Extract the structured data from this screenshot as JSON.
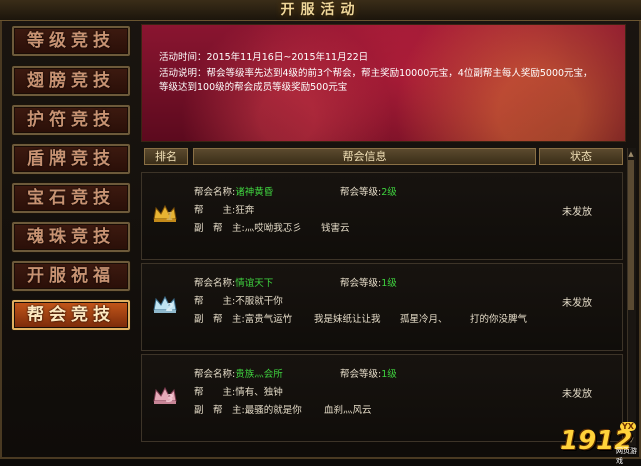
{
  "window": {
    "title": "开服活动"
  },
  "sidebar": {
    "items": [
      {
        "label": "等级竞技",
        "active": false
      },
      {
        "label": "翅膀竞技",
        "active": false
      },
      {
        "label": "护符竞技",
        "active": false
      },
      {
        "label": "盾牌竞技",
        "active": false
      },
      {
        "label": "宝石竞技",
        "active": false
      },
      {
        "label": "魂珠竞技",
        "active": false
      },
      {
        "label": "开服祝福",
        "active": false
      },
      {
        "label": "帮会竞技",
        "active": true
      }
    ]
  },
  "banner": {
    "time": "活动时间：2015年11月16日~2015年11月22日",
    "desc1": "活动说明：帮会等级率先达到4级的前3个帮会，帮主奖励10000元宝，4位副帮主每人奖励5000元宝，",
    "desc2": "等级达到100级的帮会成员等级奖励500元宝"
  },
  "table": {
    "headers": {
      "rank": "排名",
      "info": "帮会信息",
      "status": "状态"
    },
    "rows": [
      {
        "rank": "1",
        "name_label": "帮会名称:",
        "name": "诸神黄昏",
        "level_label": "帮会等级:",
        "level": "2级",
        "leader_label": "帮　　主:",
        "leader": "狂奔",
        "vice_label": "副　帮　主:",
        "vices": [
          "灬哎呦我忑彡",
          "钱害云"
        ],
        "status": "未发放"
      },
      {
        "rank": "2",
        "name_label": "帮会名称:",
        "name": "情谊天下",
        "level_label": "帮会等级:",
        "level": "1级",
        "leader_label": "帮　　主:",
        "leader": "不服就干你",
        "vice_label": "副　帮　主:",
        "vices": [
          "富贵气运竹",
          "我是妹纸让让我",
          "孤星冷月、",
          "打的你没脾气"
        ],
        "status": "未发放"
      },
      {
        "rank": "3",
        "name_label": "帮会名称:",
        "name": "贵族灬会所",
        "level_label": "帮会等级:",
        "level": "1级",
        "leader_label": "帮　　主:",
        "leader": "情有、独钟",
        "vice_label": "副　帮　主:",
        "vices": [
          "最骚的就是你",
          "血刹灬风云"
        ],
        "status": "未发放"
      }
    ]
  },
  "watermark": {
    "text": "1912",
    "sub": "网页游戏",
    "badge": "YX"
  },
  "colors": {
    "accent_gold": "#d4b05a",
    "green": "#3fd33f",
    "active_tab": "#c4571a"
  }
}
